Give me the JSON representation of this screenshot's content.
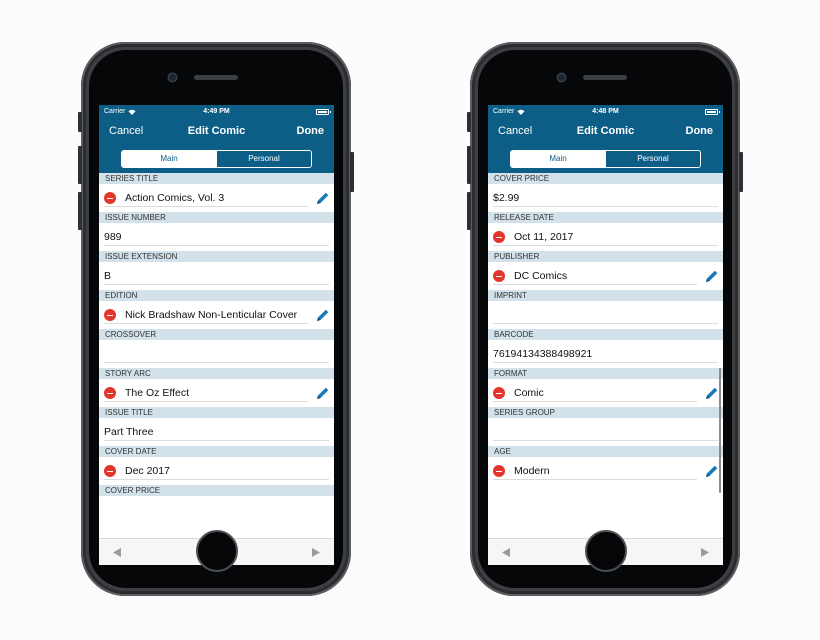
{
  "phones": [
    {
      "status": {
        "carrier": "Carrier",
        "time": "4:49 PM"
      },
      "nav": {
        "cancel": "Cancel",
        "title": "Edit Comic",
        "done": "Done"
      },
      "segments": {
        "main": "Main",
        "personal": "Personal"
      },
      "fields": [
        {
          "header": "SERIES TITLE",
          "value": "Action Comics, Vol. 3"
        },
        {
          "header": "ISSUE NUMBER",
          "value": "989"
        },
        {
          "header": "ISSUE EXTENSION",
          "value": "B"
        },
        {
          "header": "EDITION",
          "value": "Nick Bradshaw Non-Lenticular Cover"
        },
        {
          "header": "CROSSOVER",
          "value": ""
        },
        {
          "header": "STORY ARC",
          "value": "The Oz Effect"
        },
        {
          "header": "ISSUE TITLE",
          "value": "Part Three"
        },
        {
          "header": "COVER DATE",
          "value": "Dec 2017"
        },
        {
          "header": "COVER PRICE",
          "value": ""
        }
      ]
    },
    {
      "status": {
        "carrier": "Carrier",
        "time": "4:48 PM"
      },
      "nav": {
        "cancel": "Cancel",
        "title": "Edit Comic",
        "done": "Done"
      },
      "segments": {
        "main": "Main",
        "personal": "Personal"
      },
      "fields": [
        {
          "header": "COVER PRICE",
          "value": "$2.99"
        },
        {
          "header": "RELEASE DATE",
          "value": "Oct 11, 2017"
        },
        {
          "header": "PUBLISHER",
          "value": "DC Comics"
        },
        {
          "header": "IMPRINT",
          "value": ""
        },
        {
          "header": "BARCODE",
          "value": "76194134388498921"
        },
        {
          "header": "FORMAT",
          "value": "Comic"
        },
        {
          "header": "SERIES GROUP",
          "value": ""
        },
        {
          "header": "AGE",
          "value": "Modern"
        }
      ]
    }
  ],
  "icons": {
    "wifi": "wifi-icon",
    "battery": "battery-icon",
    "remove": "minus-circle-icon",
    "edit": "pencil-icon",
    "prev": "triangle-left-icon",
    "trash": "trash-icon",
    "next": "triangle-right-icon"
  },
  "colors": {
    "brand": "#0d5e87",
    "section": "#d2e1ea",
    "remove": "#e2362c",
    "pencil": "#1779b8"
  }
}
